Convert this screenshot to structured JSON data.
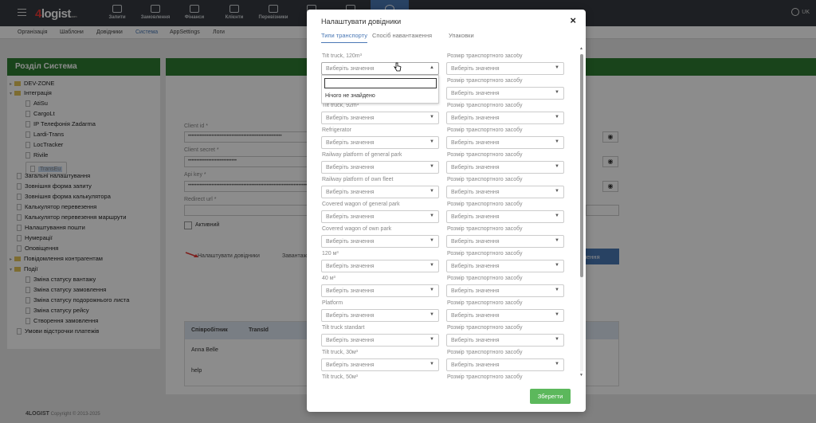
{
  "app": {
    "brand_main": "4",
    "brand_rest": "logist",
    "brand_sub": ".com"
  },
  "topnav": [
    {
      "label": "Запити"
    },
    {
      "label": "Замовлення"
    },
    {
      "label": "Фінанси"
    },
    {
      "label": "Клієнти"
    },
    {
      "label": "Перевізники"
    },
    {
      "label": ""
    },
    {
      "label": ""
    },
    {
      "label": ""
    }
  ],
  "lang": "UK",
  "subnav": [
    {
      "label": "Організація"
    },
    {
      "label": "Шаблони"
    },
    {
      "label": "Довідники"
    },
    {
      "label": "Система"
    },
    {
      "label": "AppSettings"
    },
    {
      "label": "Логи"
    }
  ],
  "sidebar": {
    "title": "Розділ Система",
    "items": [
      {
        "label": "DEV-ZONE"
      },
      {
        "label": "Інтеграція"
      },
      {
        "label": "AtiSu"
      },
      {
        "label": "CargoLt"
      },
      {
        "label": "IP Телефонія Zadarma"
      },
      {
        "label": "Lardi-Trans"
      },
      {
        "label": "LocTracker"
      },
      {
        "label": "Rivile"
      },
      {
        "label": "TransEu"
      },
      {
        "label": "Загальні налаштування"
      },
      {
        "label": "Зовнішня форма запиту"
      },
      {
        "label": "Зовнішня форма калькулятора"
      },
      {
        "label": "Калькулятор перевезення"
      },
      {
        "label": "Калькулятор перевезення маршрути"
      },
      {
        "label": "Налаштування пошти"
      },
      {
        "label": "Нумерації"
      },
      {
        "label": "Оповіщення"
      },
      {
        "label": "Повідомлення контрагентам"
      },
      {
        "label": "Події"
      },
      {
        "label": "Зміна статусу вантажу"
      },
      {
        "label": "Зміна статусу замовлення"
      },
      {
        "label": "Зміна статусу подорожнього листа"
      },
      {
        "label": "Зміна статусу рейсу"
      },
      {
        "label": "Створення замовлення"
      },
      {
        "label": "Умови відстрочки платежів"
      }
    ]
  },
  "background_form": {
    "client_id_label": "Client id *",
    "client_id_value": "••••••••••••••••••••••••••••••••••••••••••••••••••••••••",
    "client_secret_label": "Client secret *",
    "client_secret_value": "•••••••••••••••••••••••••••••",
    "api_key_label": "Api key *",
    "api_key_value": "•••••••••••••••••••••••••••••••••••••••••••••••••••••••••••••••••••••••",
    "redirect_label": "Redirect url *",
    "active_label": "Активний",
    "settings_link": "Налаштувати довідники",
    "load_link": "Завантаж",
    "connect_btn": "ключення",
    "table_headers": [
      "Співробітник",
      "TransId"
    ],
    "table_rows": [
      "Anna Belle",
      "help"
    ]
  },
  "footer": {
    "brand": "4LOGIST",
    "copyright": "Copyright © 2013-2025"
  },
  "modal": {
    "title": "Налаштувати довідники",
    "close": "×",
    "tabs": [
      {
        "label": "Типи транспорту"
      },
      {
        "label": "Спосіб навантаження"
      },
      {
        "label": "Упаковки"
      }
    ],
    "placeholder": "Виберіть значення",
    "size_label": "Розмір транспортного засобу",
    "dropdown_empty": "Нічого не знайдено",
    "rows": [
      {
        "label": "Tilt truck, 120m³"
      },
      {
        "label": ""
      },
      {
        "label": "Tilt truck, 92m³"
      },
      {
        "label": "Refrigerator"
      },
      {
        "label": "Railway platform of general park"
      },
      {
        "label": "Railway platform of own fleet"
      },
      {
        "label": "Covered wagon of general park"
      },
      {
        "label": "Covered wagon of own park"
      },
      {
        "label": "120 м³"
      },
      {
        "label": "40 м³"
      },
      {
        "label": "Platform"
      },
      {
        "label": "Tilt truck standart"
      },
      {
        "label": "Tilt truck, 30м³"
      },
      {
        "label": "Tilt truck, 50м³"
      }
    ],
    "save": "Зберегти"
  },
  "colors": {
    "topbar": "#353a40",
    "accent": "#4a78b5",
    "green_header": "#2f7d32",
    "save": "#5cb85c"
  }
}
